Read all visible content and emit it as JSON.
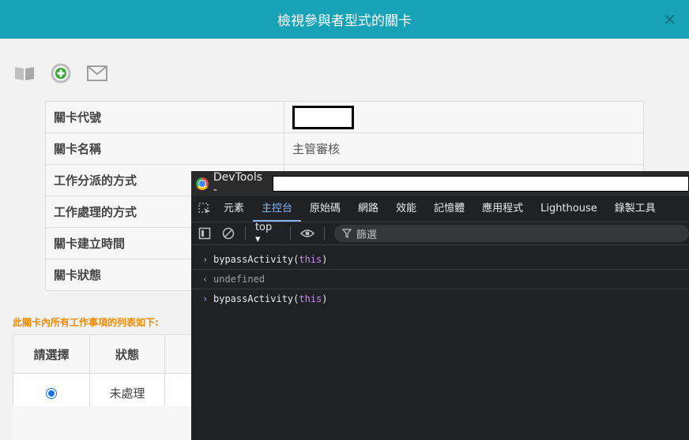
{
  "dialog": {
    "title": "檢視參與者型式的關卡",
    "close_glyph": "×"
  },
  "toolbar": {
    "icons": [
      "book-icon",
      "refresh-add-icon",
      "mail-icon"
    ]
  },
  "info_table": {
    "rows": [
      {
        "label": "關卡代號",
        "value": ""
      },
      {
        "label": "關卡名稱",
        "value": "主管審核"
      },
      {
        "label": "工作分派的方式",
        "value": ""
      },
      {
        "label": "工作處理的方式",
        "value": ""
      },
      {
        "label": "關卡建立時間",
        "value": ""
      },
      {
        "label": "關卡狀態",
        "value": ""
      }
    ]
  },
  "task_list": {
    "caption": "此關卡內所有工作事項的列表如下:",
    "headers": [
      "請選擇",
      "狀態"
    ],
    "rows": [
      {
        "status": "未處理",
        "selected": true
      }
    ]
  },
  "devtools": {
    "title": "DevTools -",
    "tabs": [
      "元素",
      "主控台",
      "原始碼",
      "網路",
      "效能",
      "記憶體",
      "應用程式",
      "Lighthouse",
      "錄製工具"
    ],
    "active_tab": "主控台",
    "context": "top ▾",
    "filter_placeholder": "篩選",
    "console": {
      "entry1_fn": "bypassActivity(",
      "entry1_kw": "this",
      "entry1_close": ")",
      "result1": "undefined",
      "entry2_fn": "bypassActivity(",
      "entry2_kw": "this",
      "entry2_close": ")"
    }
  }
}
